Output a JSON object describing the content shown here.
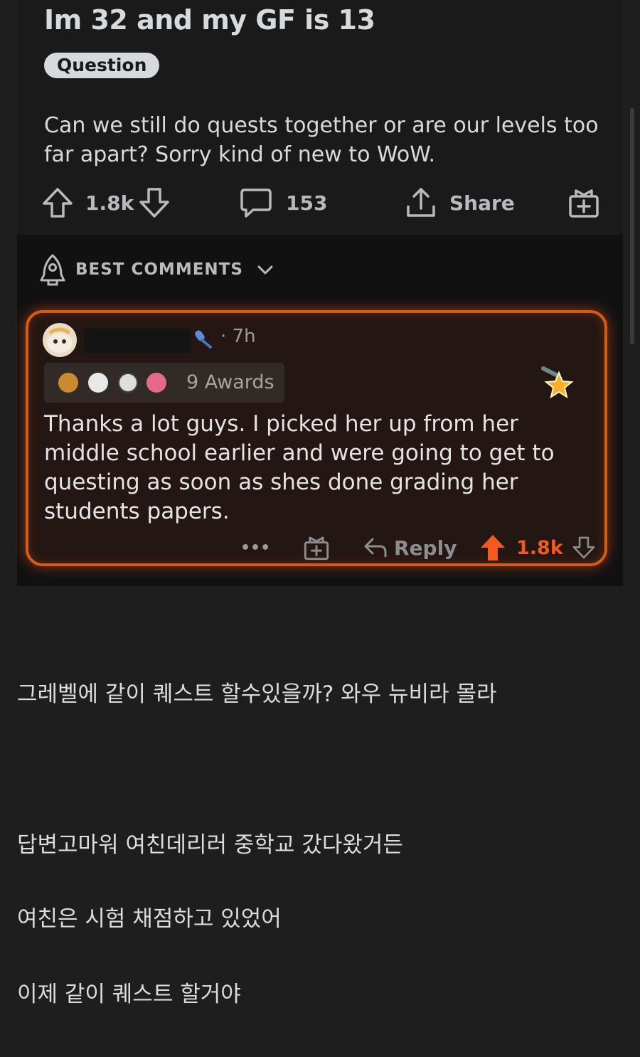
{
  "post": {
    "title": "Im 32 and my GF is 13",
    "flair": "Question",
    "body": "Can we still do quests together or are our levels too far apart? Sorry kind of new to WoW.",
    "upvotes": "1.8k",
    "comments": "153",
    "share_label": "Share"
  },
  "best_comments": {
    "label": "BEST COMMENTS"
  },
  "comment": {
    "time": "· 7h",
    "awards_label": "9 Awards",
    "text": "Thanks a lot guys. I picked her up from her middle school earlier and were going to get to questing as soon as shes done grading her students papers.",
    "more": "•••",
    "reply_label": "Reply",
    "score": "1.8k",
    "accent_color": "#f25a20"
  },
  "captions": [
    "그레벨에 같이 퀘스트 할수있을까? 와우 뉴비라 몰라",
    "답변고마워 여친데리러 중학교 갔다왔거든",
    "여친은 시험 채점하고 있었어",
    "이제 같이 퀘스트 할거야"
  ]
}
